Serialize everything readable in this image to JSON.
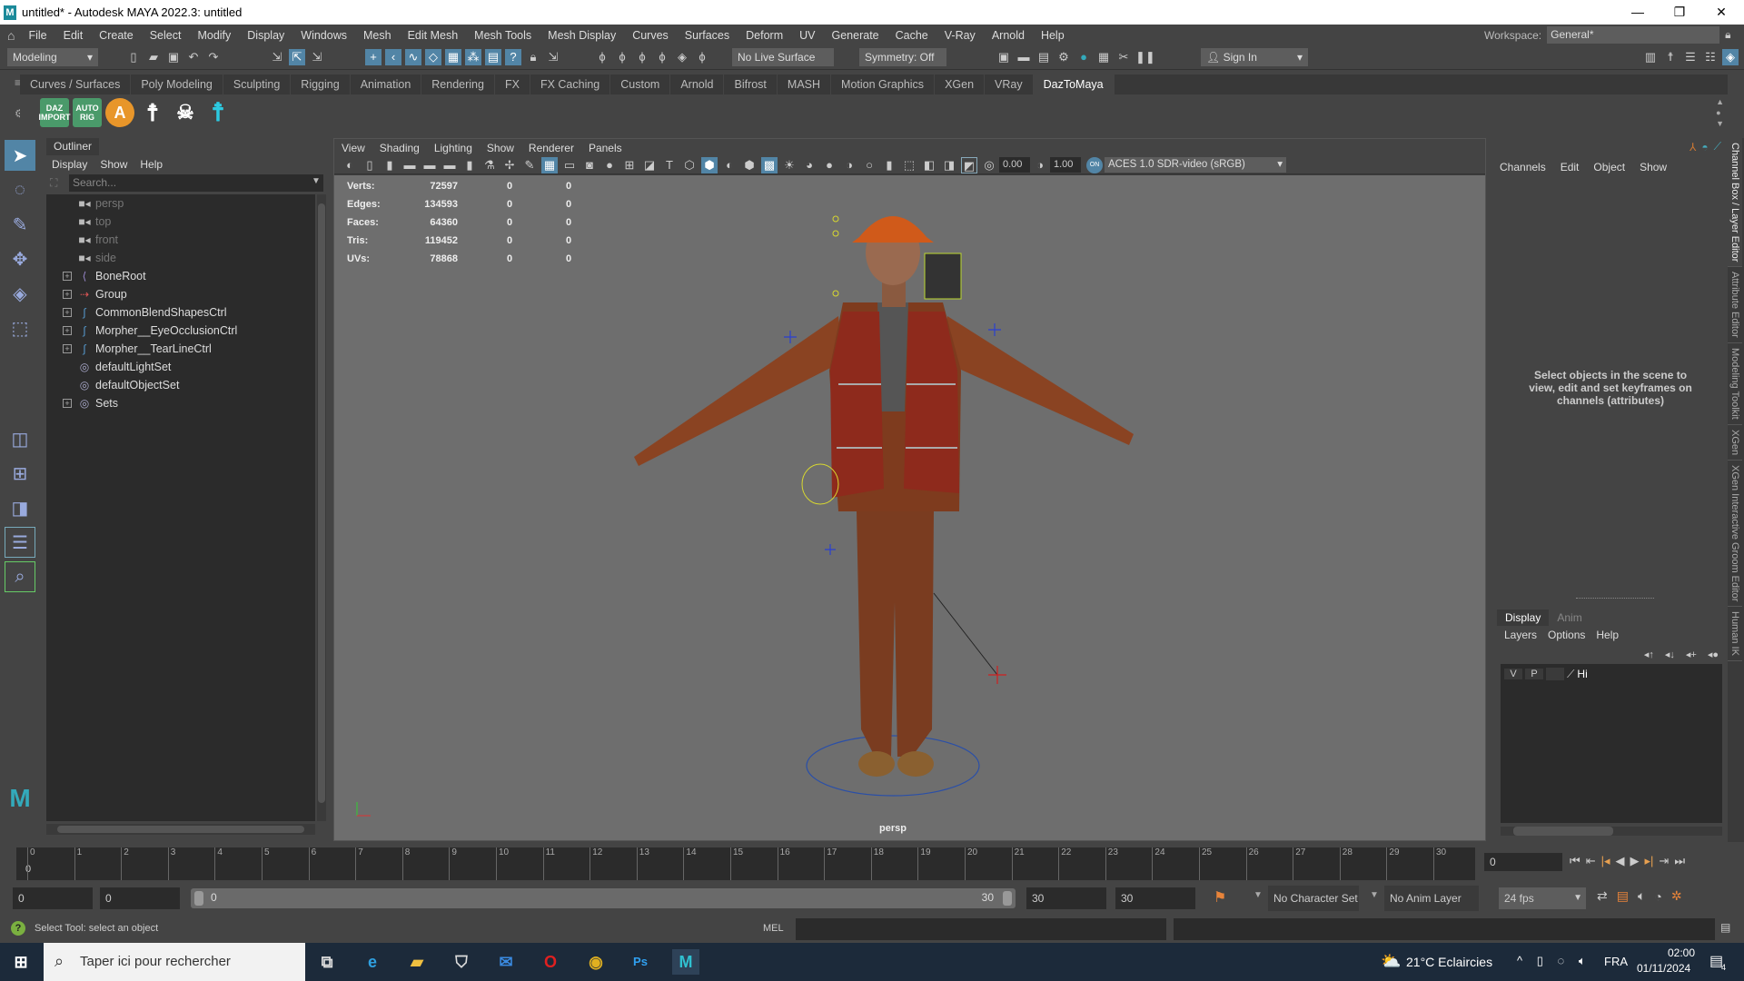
{
  "window": {
    "title": "untitled* - Autodesk MAYA 2022.3: untitled",
    "logo": "M"
  },
  "menubar": [
    "File",
    "Edit",
    "Create",
    "Select",
    "Modify",
    "Display",
    "Windows",
    "Mesh",
    "Edit Mesh",
    "Mesh Tools",
    "Mesh Display",
    "Curves",
    "Surfaces",
    "Deform",
    "UV",
    "Generate",
    "Cache",
    "V-Ray",
    "Arnold",
    "Help"
  ],
  "workspace": {
    "label": "Workspace:",
    "value": "General*"
  },
  "statusline": {
    "mode": "Modeling",
    "live_surface": "No Live Surface",
    "symmetry": "Symmetry: Off",
    "sign_in": "Sign In"
  },
  "shelf_tabs": [
    "Curves / Surfaces",
    "Poly Modeling",
    "Sculpting",
    "Rigging",
    "Animation",
    "Rendering",
    "FX",
    "FX Caching",
    "Custom",
    "Arnold",
    "Bifrost",
    "MASH",
    "Motion Graphics",
    "XGen",
    "VRay",
    "DazToMaya"
  ],
  "shelf_active": "DazToMaya",
  "shelf_icons": [
    {
      "label": "DAZ IMPORT",
      "color": "#4a9a6a"
    },
    {
      "label": "AUTO RIG",
      "color": "#4a9a6a"
    },
    {
      "label": "A",
      "color": "#e8962a"
    }
  ],
  "outliner": {
    "title": "Outliner",
    "menu": [
      "Display",
      "Show",
      "Help"
    ],
    "search_placeholder": "Search...",
    "items": [
      {
        "label": "persp",
        "icon": "camera-icon",
        "camera": true,
        "expand": false
      },
      {
        "label": "top",
        "icon": "camera-icon",
        "camera": true,
        "expand": false
      },
      {
        "label": "front",
        "icon": "camera-icon",
        "camera": true,
        "expand": false
      },
      {
        "label": "side",
        "icon": "camera-icon",
        "camera": true,
        "expand": false
      },
      {
        "label": "BoneRoot",
        "icon": "joint-icon",
        "expand": true
      },
      {
        "label": "Group",
        "icon": "group-icon",
        "expand": true
      },
      {
        "label": "CommonBlendShapesCtrl",
        "icon": "curve-icon",
        "expand": true
      },
      {
        "label": "Morpher__EyeOcclusionCtrl",
        "icon": "curve-icon",
        "expand": true
      },
      {
        "label": "Morpher__TearLineCtrl",
        "icon": "curve-icon",
        "expand": true
      },
      {
        "label": "defaultLightSet",
        "icon": "set-icon",
        "expand": false
      },
      {
        "label": "defaultObjectSet",
        "icon": "set-icon",
        "expand": false
      },
      {
        "label": "Sets",
        "icon": "set-icon",
        "expand": true
      }
    ]
  },
  "viewport": {
    "menu": [
      "View",
      "Shading",
      "Lighting",
      "Show",
      "Renderer",
      "Panels"
    ],
    "exposure": "0.00",
    "gamma": "1.00",
    "color_space": "ACES 1.0 SDR-video (sRGB)",
    "on_badge": "ON",
    "camera": "persp",
    "hud": [
      {
        "label": "Verts:",
        "v1": "72597",
        "v2": "0",
        "v3": "0"
      },
      {
        "label": "Edges:",
        "v1": "134593",
        "v2": "0",
        "v3": "0"
      },
      {
        "label": "Faces:",
        "v1": "64360",
        "v2": "0",
        "v3": "0"
      },
      {
        "label": "Tris:",
        "v1": "119452",
        "v2": "0",
        "v3": "0"
      },
      {
        "label": "UVs:",
        "v1": "78868",
        "v2": "0",
        "v3": "0"
      }
    ]
  },
  "channelbox": {
    "menu": [
      "Channels",
      "Edit",
      "Object",
      "Show"
    ],
    "message": "Select objects in the scene to view, edit and set keyframes on channels (attributes)"
  },
  "layer_editor": {
    "tabs": [
      "Display",
      "Anim"
    ],
    "menu": [
      "Layers",
      "Options",
      "Help"
    ],
    "layer": {
      "v": "V",
      "p": "P",
      "name": "Hi"
    }
  },
  "side_tabs": [
    "Channel Box / Layer Editor",
    "Attribute Editor",
    "Modeling Toolkit",
    "XGen",
    "XGen Interactive Groom Editor",
    "Human IK"
  ],
  "timeline": {
    "ticks": [
      "0",
      "1",
      "2",
      "3",
      "4",
      "5",
      "6",
      "7",
      "8",
      "9",
      "10",
      "11",
      "12",
      "13",
      "14",
      "15",
      "16",
      "17",
      "18",
      "19",
      "20",
      "21",
      "22",
      "23",
      "24",
      "25",
      "26",
      "27",
      "28",
      "29",
      "30"
    ],
    "current": "0",
    "current_field": "0"
  },
  "range": {
    "start": "0",
    "anim_start": "0",
    "slider_start": "0",
    "slider_end": "30",
    "anim_end": "30",
    "end": "30",
    "character_set": "No Character Set",
    "anim_layer": "No Anim Layer",
    "fps": "24 fps"
  },
  "commandline": {
    "help": "Select Tool: select an object",
    "lang": "MEL"
  },
  "taskbar": {
    "search": "Taper ici pour rechercher",
    "weather": "21°C  Eclaircies",
    "lang": "FRA",
    "time": "02:00",
    "date": "01/11/2024",
    "notif": "4"
  }
}
